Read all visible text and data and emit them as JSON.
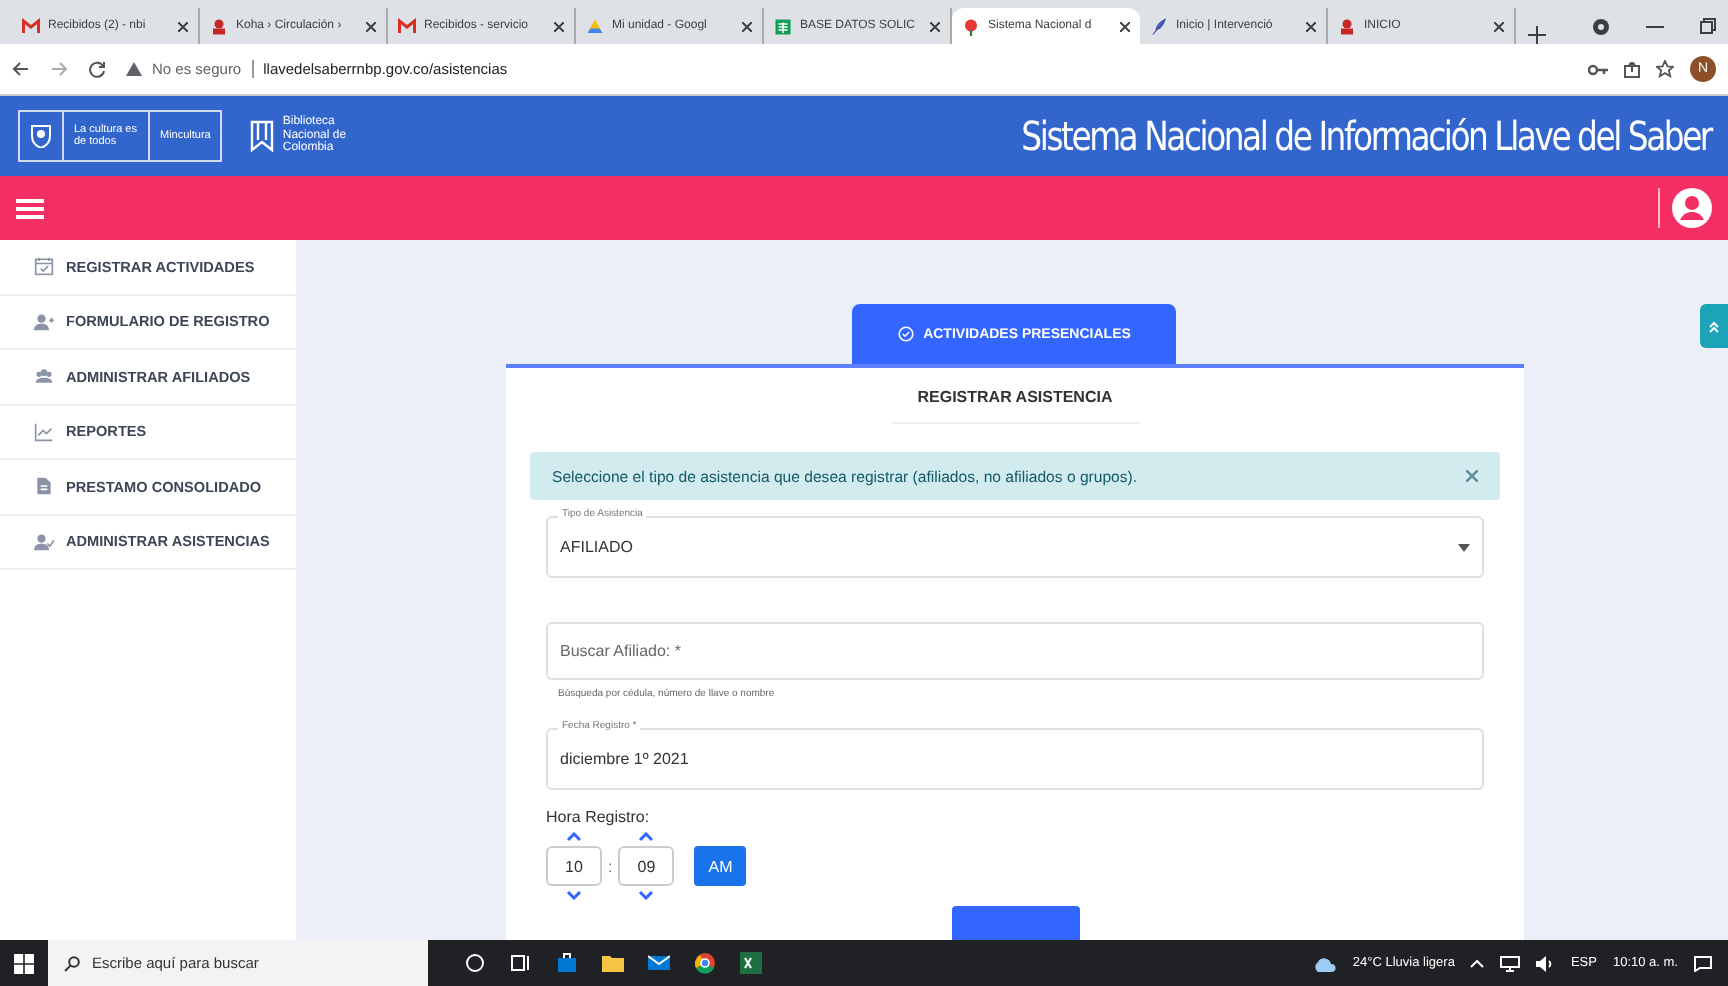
{
  "browser": {
    "tabs": [
      {
        "title": "Recibidos (2) - nbi",
        "kind": "mail",
        "selected": false
      },
      {
        "title": "Koha › Circulación ›",
        "kind": "koha",
        "selected": false
      },
      {
        "title": "Recibidos - servicio",
        "kind": "mail",
        "selected": false
      },
      {
        "title": "Mi unidad - Googl",
        "kind": "drive",
        "selected": false
      },
      {
        "title": "BASE DATOS SOLIC",
        "kind": "sheet",
        "selected": false
      },
      {
        "title": "Sistema Nacional d",
        "kind": "flower",
        "selected": true
      },
      {
        "title": "Inicio | Intervenció",
        "kind": "feather",
        "selected": false
      },
      {
        "title": "INICIO",
        "kind": "koha",
        "selected": false
      }
    ],
    "security": "No es seguro",
    "url": "llavedelsaberrnbp.gov.co/asistencias",
    "profile": "N"
  },
  "header": {
    "logo_left": "La cultura es de todos",
    "logo_ministry": "Mincultura",
    "library": [
      "Biblioteca",
      "Nacional de",
      "Colombia"
    ],
    "title": "Sistema Nacional de Información Llave del Saber"
  },
  "sidebar": {
    "items": [
      {
        "label": "REGISTRAR ACTIVIDADES",
        "kind": "calendar"
      },
      {
        "label": "FORMULARIO DE REGISTRO",
        "kind": "user-add"
      },
      {
        "label": "ADMINISTRAR AFILIADOS",
        "kind": "users"
      },
      {
        "label": "REPORTES",
        "kind": "chart"
      },
      {
        "label": "PRESTAMO CONSOLIDADO",
        "kind": "file"
      },
      {
        "label": "ADMINISTRAR ASISTENCIAS",
        "kind": "user-check"
      }
    ]
  },
  "tab": {
    "label": "ACTIVIDADES PRESENCIALES",
    "selected": true
  },
  "form": {
    "title": "REGISTRAR ASISTENCIA",
    "alert": "Seleccione el tipo de asistencia que desea registrar (afiliados, no afiliados o grupos).",
    "type_field": {
      "label": "Tipo de Asistencia",
      "value": "AFILIADO"
    },
    "search_field": {
      "placeholder": "Buscar Afiliado: *",
      "hint": "Búsqueda por cédula, número de llave o nombre"
    },
    "date_field": {
      "label": "Fecha Registro *",
      "value": "diciembre 1º 2021"
    },
    "time": {
      "label": "Hora Registro:",
      "hour": "10",
      "separator": ":",
      "minute": "09",
      "period": "AM"
    }
  },
  "taskbar": {
    "search_placeholder": "Escribe aquí para buscar",
    "weather": "24°C  Lluvia ligera",
    "language": "ESP",
    "clock": "10:10 a. m."
  }
}
